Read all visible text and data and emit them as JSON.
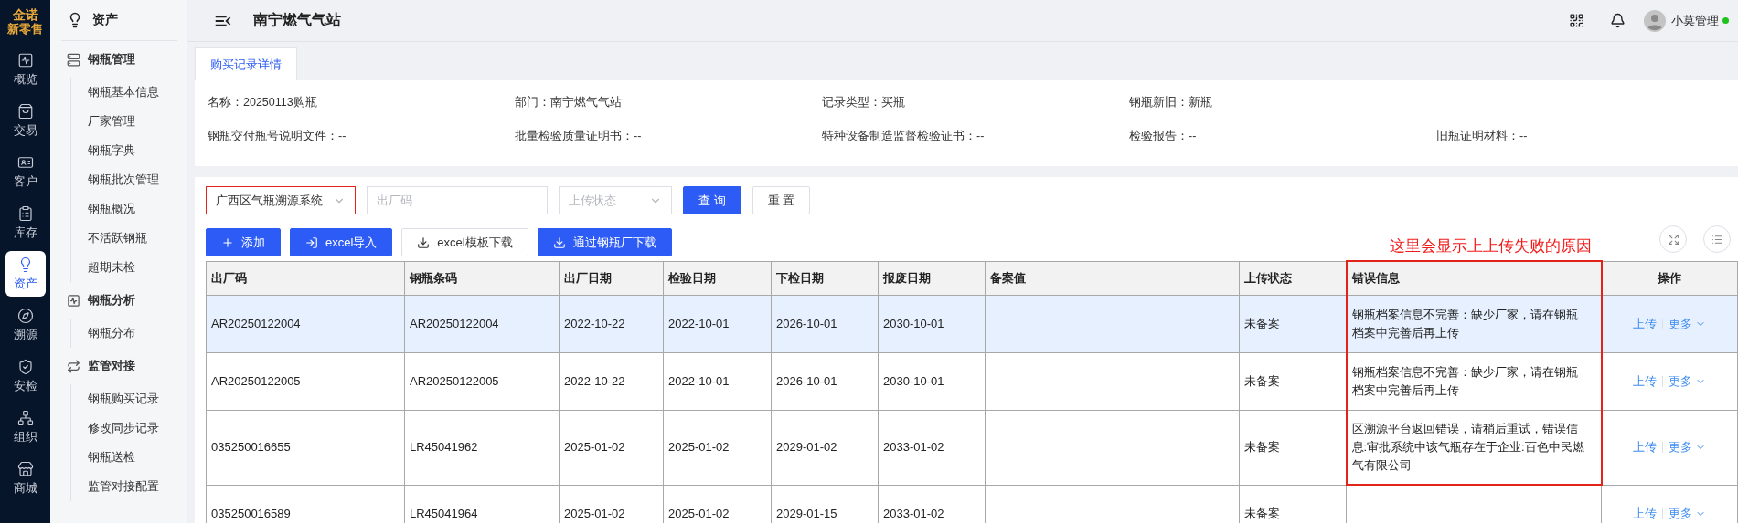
{
  "brand": {
    "logo": "金诺",
    "subtitle": "新零售"
  },
  "rail": [
    {
      "label": "概览",
      "selected": false
    },
    {
      "label": "交易",
      "selected": false
    },
    {
      "label": "客户",
      "selected": false
    },
    {
      "label": "库存",
      "selected": false
    },
    {
      "label": "资产",
      "selected": true
    },
    {
      "label": "溯源",
      "selected": false
    },
    {
      "label": "安检",
      "selected": false
    },
    {
      "label": "组织",
      "selected": false
    },
    {
      "label": "商城",
      "selected": false
    }
  ],
  "submenu": {
    "title": "资产",
    "groups": [
      {
        "label": "钢瓶管理",
        "items": [
          "钢瓶基本信息",
          "厂家管理",
          "钢瓶字典",
          "钢瓶批次管理",
          "钢瓶概况",
          "不活跃钢瓶",
          "超期未检"
        ]
      },
      {
        "label": "钢瓶分析",
        "items": [
          "钢瓶分布"
        ]
      },
      {
        "label": "监管对接",
        "items": [
          "钢瓶购买记录",
          "修改同步记录",
          "钢瓶送检",
          "监管对接配置"
        ]
      }
    ]
  },
  "header": {
    "title": "南宁燃气气站",
    "user": "小莫管理",
    "online": true
  },
  "tabs": [
    {
      "label": "购买记录详情",
      "selected": true
    }
  ],
  "details": [
    [
      {
        "label": "名称：",
        "value": "20250113购瓶"
      },
      {
        "label": "部门：",
        "value": "南宁燃气气站"
      },
      {
        "label": "记录类型：",
        "value": "买瓶"
      },
      {
        "label": "钢瓶新旧：",
        "value": "新瓶"
      }
    ],
    [
      {
        "label": "钢瓶交付瓶号说明文件：",
        "value": "--"
      },
      {
        "label": "批量检验质量证明书：",
        "value": "--"
      },
      {
        "label": "特种设备制造监督检验证书：",
        "value": "--"
      },
      {
        "label": "检验报告：",
        "value": "--"
      },
      {
        "label": "旧瓶证明材料：",
        "value": "--"
      }
    ]
  ],
  "filters": [
    {
      "kind": "select",
      "value": "广西区气瓶溯源系统",
      "highlighted": true
    },
    {
      "kind": "input",
      "placeholder": "出厂码",
      "highlighted": false
    },
    {
      "kind": "select",
      "placeholder": "上传状态",
      "highlighted": false
    }
  ],
  "filter_buttons": [
    {
      "label": "查 询",
      "primary": true
    },
    {
      "label": "重 置",
      "primary": false
    }
  ],
  "actions": [
    {
      "label": "添加",
      "primary": true
    },
    {
      "label": "excel导入",
      "primary": true
    },
    {
      "label": "excel模板下载",
      "primary": false
    },
    {
      "label": "通过钢瓶厂下载",
      "primary": true
    }
  ],
  "annotation": {
    "text": "这里会显示上上传失败的原因"
  },
  "table": {
    "columns": [
      {
        "label": "出厂码",
        "highlighted": false
      },
      {
        "label": "钢瓶条码",
        "highlighted": false
      },
      {
        "label": "出厂日期",
        "highlighted": false
      },
      {
        "label": "检验日期",
        "highlighted": false
      },
      {
        "label": "下检日期",
        "highlighted": false
      },
      {
        "label": "报废日期",
        "highlighted": false
      },
      {
        "label": "备案值",
        "highlighted": false
      },
      {
        "label": "上传状态",
        "highlighted": false
      },
      {
        "label": "错误信息",
        "highlighted": true
      },
      {
        "label": "操作",
        "highlighted": false
      }
    ],
    "rows": [
      {
        "selected": true,
        "highlighted": true,
        "factory_code": "AR20250122004",
        "barcode": "AR20250122004",
        "made": "2022-10-22",
        "inspected": "2022-10-01",
        "next_inspection": "2026-10-01",
        "scrap": "2030-10-01",
        "upload_status": "未备案",
        "error": "钢瓶档案信息不完善：缺少厂家，请在钢瓶档案中完善后再上传",
        "upload": "上传",
        "more": "更多"
      },
      {
        "selected": false,
        "highlighted": true,
        "factory_code": "AR20250122005",
        "barcode": "AR20250122005",
        "made": "2022-10-22",
        "inspected": "2022-10-01",
        "next_inspection": "2026-10-01",
        "scrap": "2030-10-01",
        "upload_status": "未备案",
        "error": "钢瓶档案信息不完善：缺少厂家，请在钢瓶档案中完善后再上传",
        "upload": "上传",
        "more": "更多"
      },
      {
        "selected": false,
        "highlighted": true,
        "factory_code": "035250016655",
        "barcode": "LR45041962",
        "made": "2025-01-02",
        "inspected": "2025-01-02",
        "next_inspection": "2029-01-02",
        "scrap": "2033-01-02",
        "upload_status": "未备案",
        "error": "区溯源平台返回错误，请稍后重试，错误信息:审批系统中该气瓶存在于企业:百色中民燃气有限公司",
        "upload": "上传",
        "more": "更多"
      },
      {
        "selected": false,
        "highlighted": false,
        "factory_code": "035250016589",
        "barcode": "LR45041964",
        "made": "2025-01-02",
        "inspected": "2025-01-02",
        "next_inspection": "2029-01-15",
        "scrap": "2033-01-02",
        "upload_status": "未备案",
        "upload": "上传",
        "more": "更多"
      }
    ]
  }
}
